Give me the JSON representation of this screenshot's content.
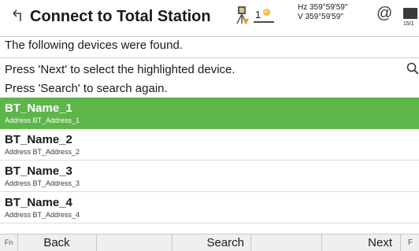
{
  "header": {
    "title": "Connect to Total Station",
    "satellite_count": "1",
    "hz_angle": "Hz 359°59'59\"",
    "v_angle": "V  359°59'59\"",
    "at_symbol": "@",
    "battery_label": "15/1"
  },
  "messages": {
    "line1": "The following devices were found.",
    "line2": "Press 'Next' to select the highlighted device.",
    "line3": "Press 'Search' to search again."
  },
  "devices": [
    {
      "name": "BT_Name_1",
      "address": "Address  BT_Address_1",
      "selected": true
    },
    {
      "name": "BT_Name_2",
      "address": "Address  BT_Address_2",
      "selected": false
    },
    {
      "name": "BT_Name_3",
      "address": "Address  BT_Address_3",
      "selected": false
    },
    {
      "name": "BT_Name_4",
      "address": "Address  BT_Address_4",
      "selected": false
    }
  ],
  "footer": {
    "fn_label": "Fn",
    "back_label": "Back",
    "search_label": "Search",
    "next_label": "Next",
    "more_label": "F"
  },
  "icons": {
    "back": "back-arrow-icon",
    "search": "search-icon",
    "station": "total-station-icon",
    "satellite": "satellite-icon",
    "battery": "battery-icon"
  },
  "colors": {
    "selected_row": "#5eb54a",
    "selected_text": "#ffffff"
  }
}
